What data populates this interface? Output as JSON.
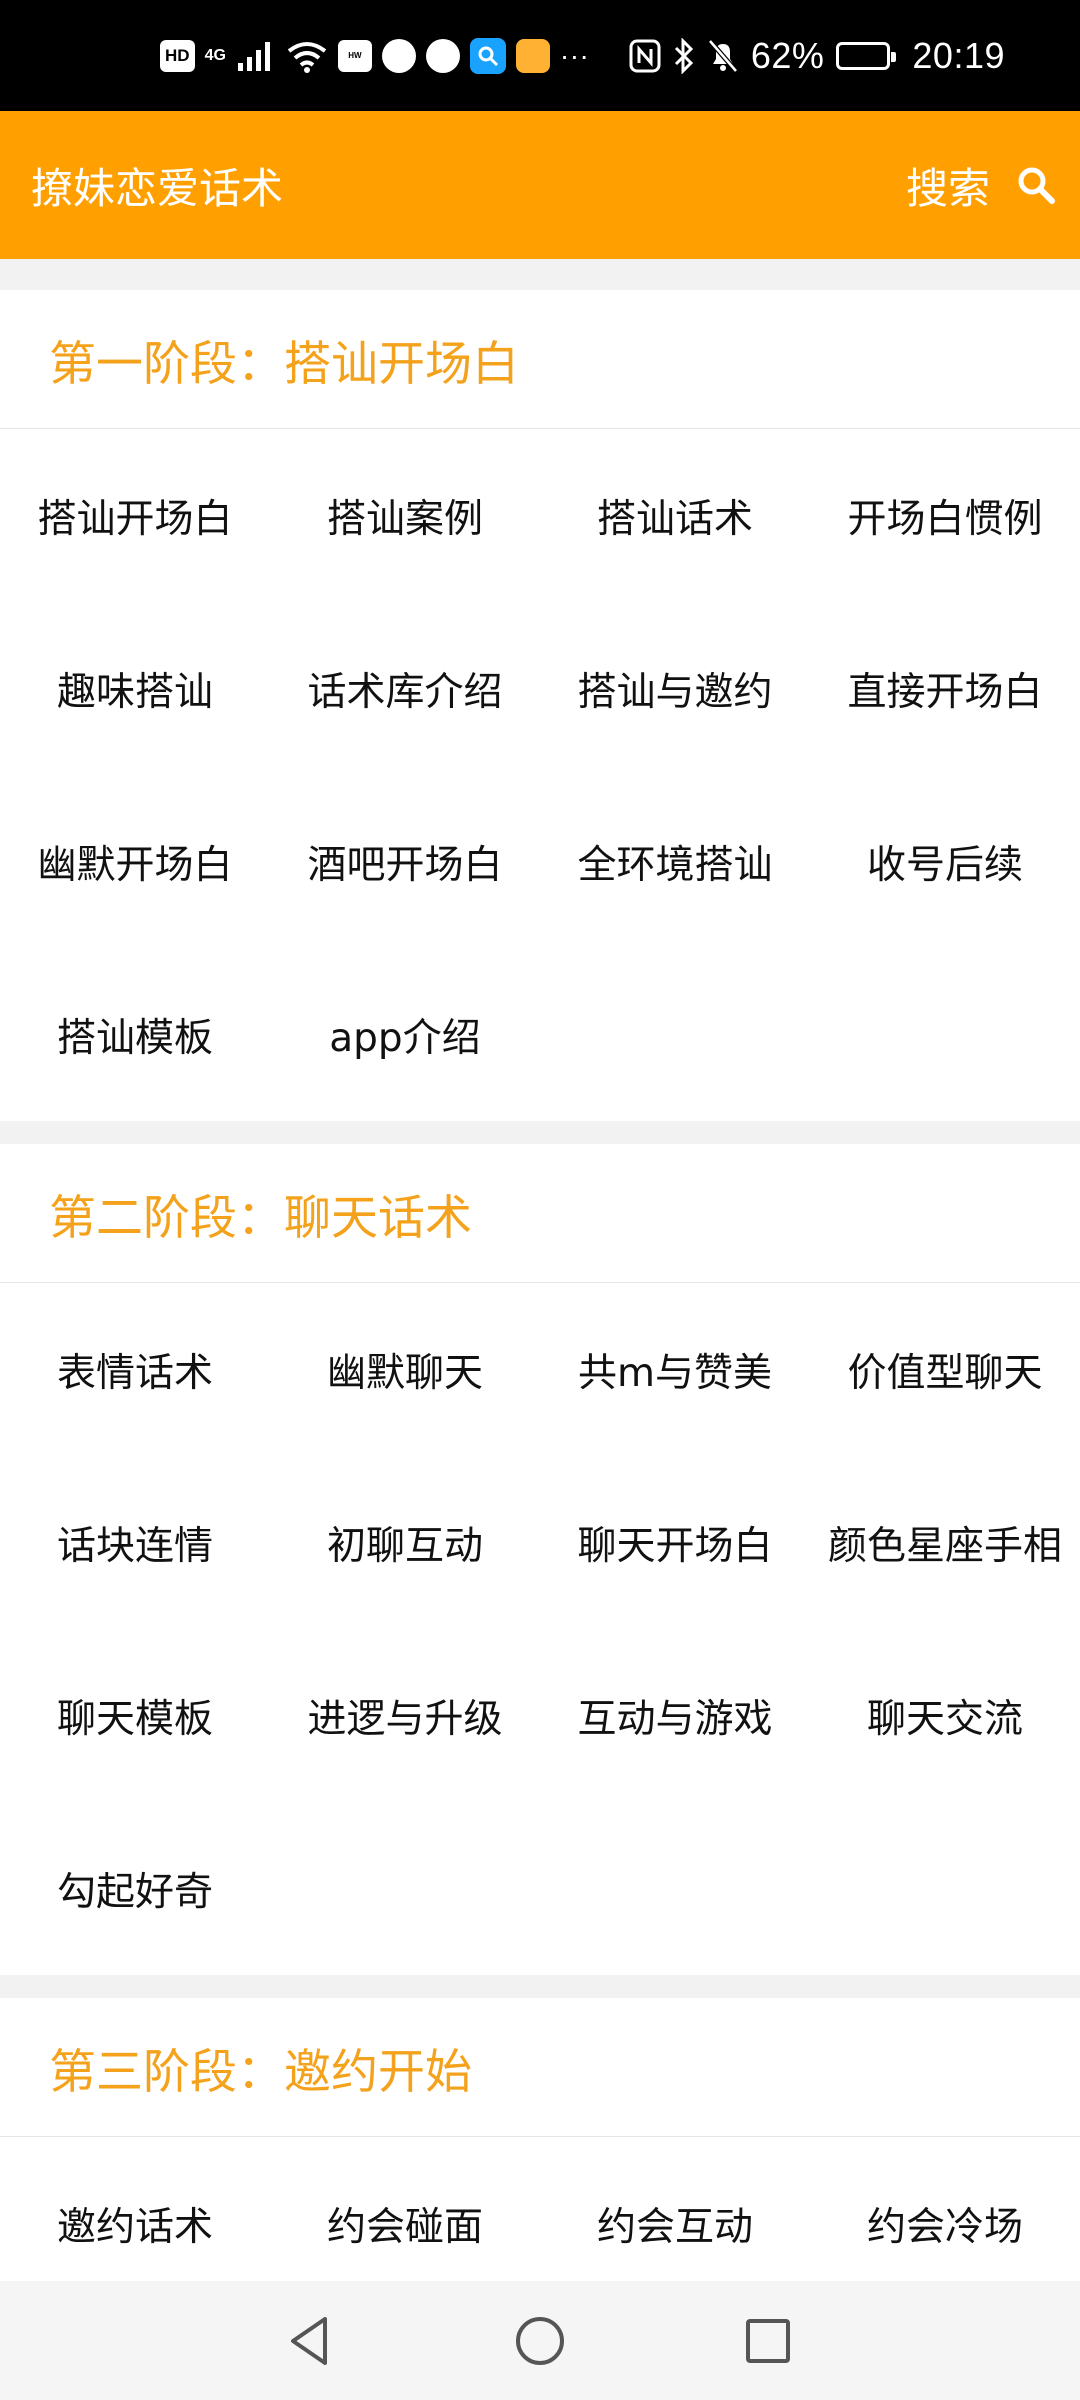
{
  "status_bar": {
    "hd_label": "HD",
    "network_label": "4G",
    "more_label": "···",
    "battery_percent": "62%",
    "time": "20:19"
  },
  "app_bar": {
    "title": "撩妹恋爱话术",
    "search_label": "搜索",
    "color": "#ffa000"
  },
  "sections": [
    {
      "title": "第一阶段：搭讪开场白",
      "items": [
        "搭讪开场白",
        "搭讪案例",
        "搭讪话术",
        "开场白惯例",
        "趣味搭讪",
        "话术库介绍",
        "搭讪与邀约",
        "直接开场白",
        "幽默开场白",
        "酒吧开场白",
        "全环境搭讪",
        "收号后续",
        "搭讪模板",
        "app介绍"
      ]
    },
    {
      "title": "第二阶段：聊天话术",
      "items": [
        "表情话术",
        "幽默聊天",
        "共m与赞美",
        "价值型聊天",
        "话块连情",
        "初聊互动",
        "聊天开场白",
        "颜色星座手相",
        "聊天模板",
        "进逻与升级",
        "互动与游戏",
        "聊天交流",
        "勾起好奇"
      ]
    },
    {
      "title": "第三阶段：邀约开始",
      "items": [
        "邀约话术",
        "约会碰面",
        "约会互动",
        "约会冷场"
      ]
    }
  ],
  "nav_bar": {
    "back_icon": "triangle-back-icon",
    "home_icon": "circle-home-icon",
    "recents_icon": "square-recents-icon"
  },
  "colors": {
    "accent": "#ffa000",
    "section_title": "#f4a21b"
  }
}
